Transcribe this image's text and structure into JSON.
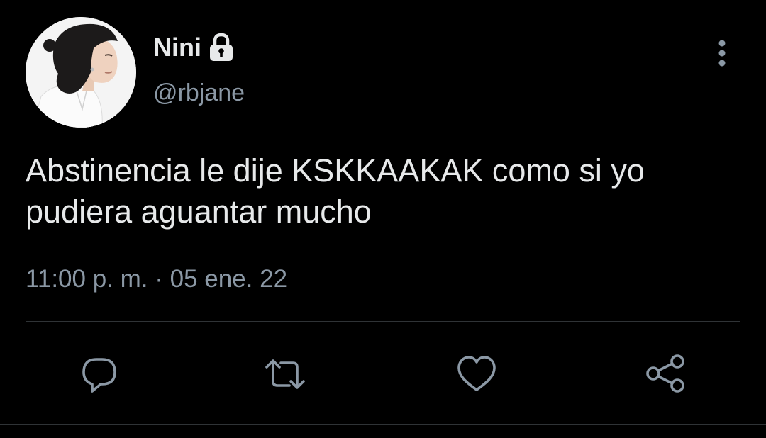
{
  "tweet": {
    "author": {
      "display_name": "Nini",
      "handle": "@rbjane",
      "protected_icon": "lock-icon",
      "avatar": "profile-photo"
    },
    "more_icon": "vertical-ellipsis-icon",
    "text": "Abstinencia le dije KSKKAAKAK como si yo pudiera aguantar mucho",
    "timestamp": "11:00 p. m. · 05 ene. 22",
    "actions": [
      {
        "name": "reply",
        "icon": "speech-bubble-icon"
      },
      {
        "name": "retweet",
        "icon": "retweet-arrows-icon"
      },
      {
        "name": "like",
        "icon": "heart-icon"
      },
      {
        "name": "share",
        "icon": "share-nodes-icon"
      }
    ]
  },
  "colors": {
    "background": "#000000",
    "primary_text": "#e7e9ea",
    "secondary_text": "#8b98a5",
    "divider": "#2f3336"
  }
}
